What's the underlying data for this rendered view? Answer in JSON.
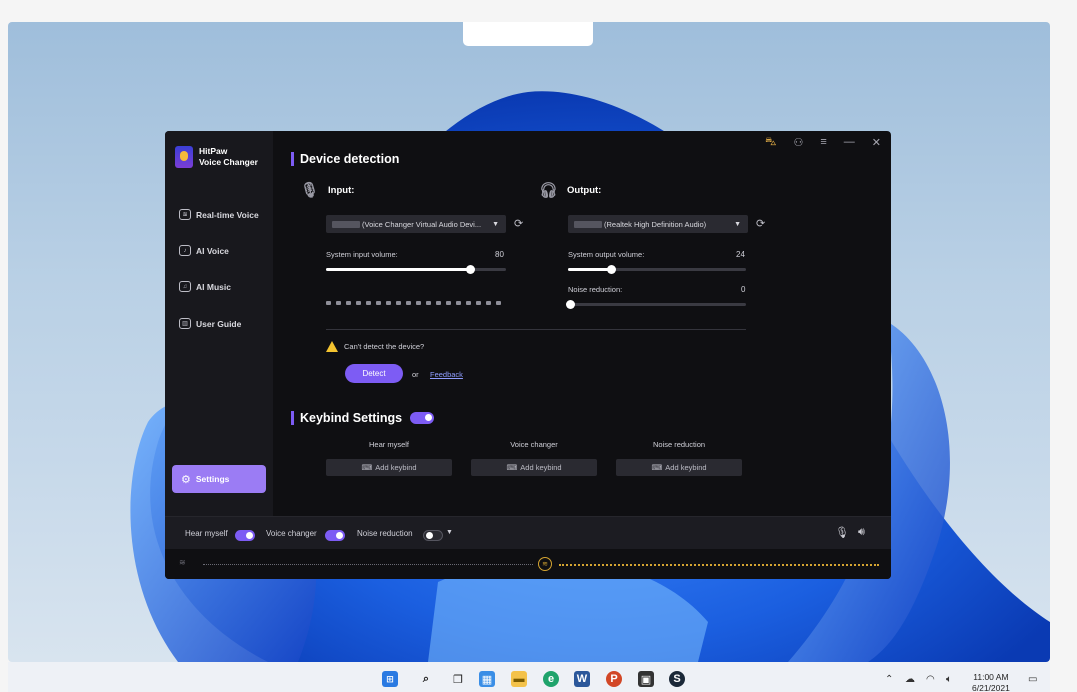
{
  "app": {
    "brand_line1": "HitPaw",
    "brand_line2": "Voice Changer",
    "nav": [
      {
        "label": "Real-time Voice",
        "icon": "waveform-icon"
      },
      {
        "label": "AI Voice",
        "icon": "ai-voice-icon"
      },
      {
        "label": "AI Music",
        "icon": "ai-music-icon"
      },
      {
        "label": "User Guide",
        "icon": "book-icon"
      }
    ],
    "settings_label": "Settings",
    "device_detection_title": "Device detection",
    "input": {
      "heading": "Input:",
      "device": "(Voice Changer Virtual Audio Devi...",
      "volume_label": "System input volume:",
      "volume_value": "80"
    },
    "output": {
      "heading": "Output:",
      "device": "(Realtek High Definition Audio)",
      "volume_label": "System output volume:",
      "volume_value": "24",
      "noise_label": "Noise reduction:",
      "noise_value": "0"
    },
    "warning_text": "Can't detect the device?",
    "detect_label": "Detect",
    "or_label": "or",
    "feedback_label": "Feedback",
    "keybind_title": "Keybind Settings",
    "keybind_enabled": true,
    "keybinds": [
      {
        "heading": "Hear myself",
        "button": "Add keybind"
      },
      {
        "heading": "Voice changer",
        "button": "Add keybind"
      },
      {
        "heading": "Noise reduction",
        "button": "Add keybind"
      }
    ],
    "bottom": {
      "hear_myself": "Hear myself",
      "voice_changer": "Voice changer",
      "noise_reduction": "Noise reduction",
      "hear_myself_on": true,
      "voice_changer_on": true,
      "noise_reduction_on": false
    },
    "accent_color": "#7d5cf4",
    "playback_color": "#d4a431"
  },
  "taskbar": {
    "time": "11:00 AM",
    "date": "6/21/2021"
  }
}
